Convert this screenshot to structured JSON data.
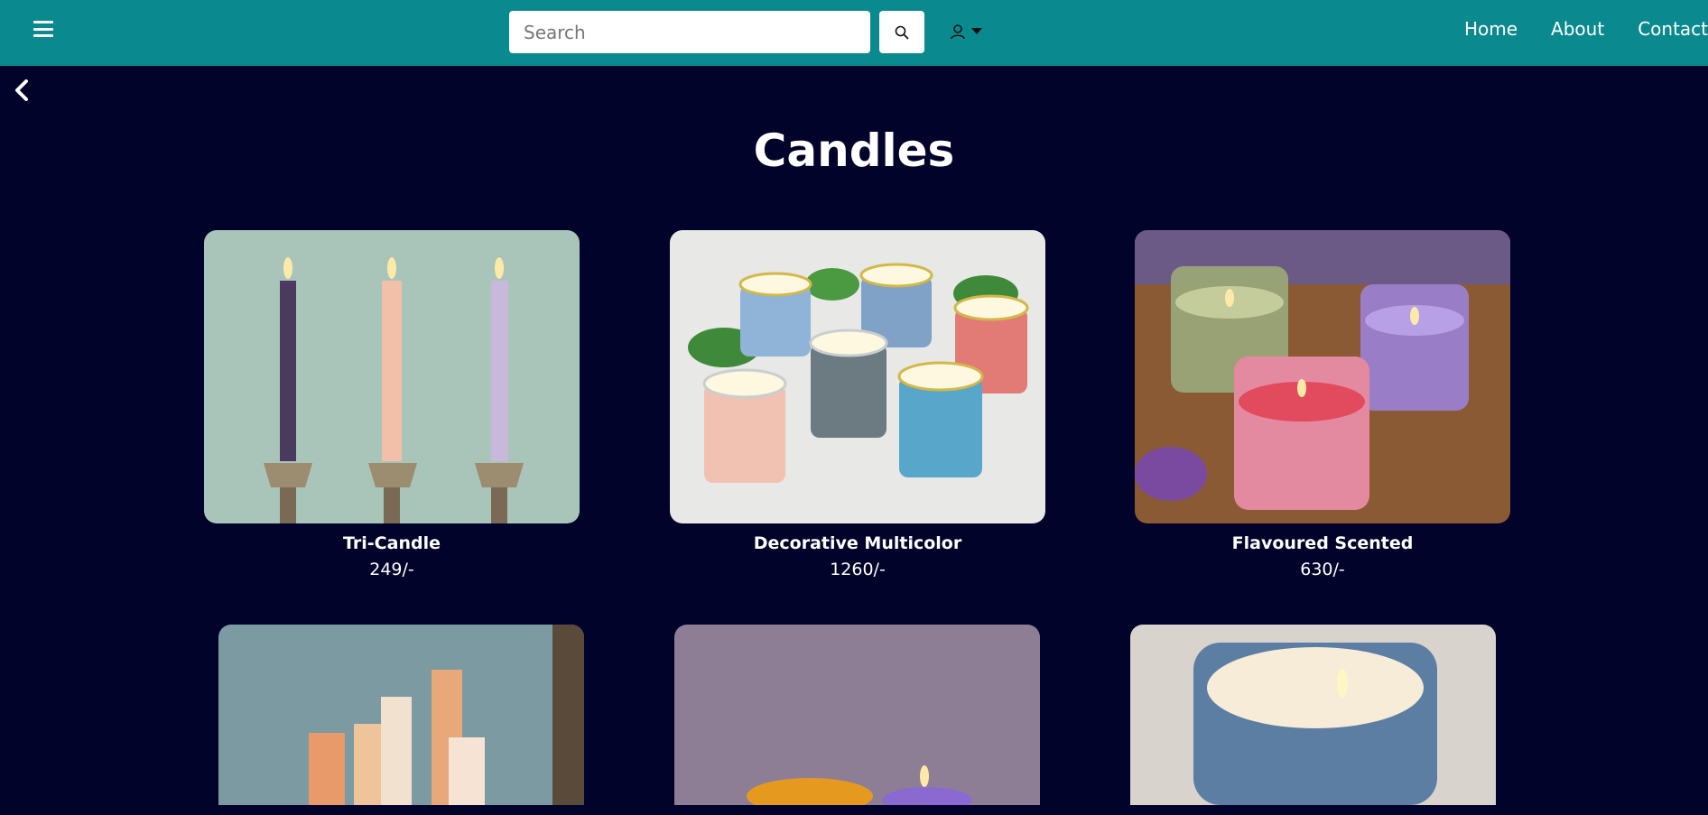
{
  "header": {
    "menu_icon": "hamburger-icon",
    "search": {
      "placeholder": "Search",
      "value": ""
    },
    "search_icon": "magnifier-icon",
    "user_icon": "user-icon",
    "nav": [
      "Home",
      "About",
      "Contact"
    ],
    "accent_color": "#0a8a8f"
  },
  "back_icon": "chevron-left-icon",
  "page": {
    "title": "Candles",
    "background_color": "#02032a"
  },
  "products": [
    {
      "name": "Tri-Candle",
      "price": "249/-"
    },
    {
      "name": "Decorative Multicolor",
      "price": "1260/-"
    },
    {
      "name": "Flavoured Scented",
      "price": "630/-"
    },
    {
      "name": "",
      "price": ""
    },
    {
      "name": "",
      "price": ""
    },
    {
      "name": "",
      "price": ""
    }
  ]
}
